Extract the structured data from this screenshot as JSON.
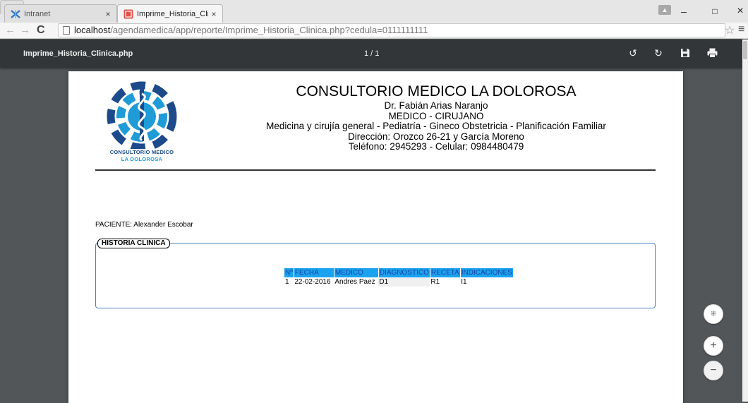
{
  "browser": {
    "tabs": [
      {
        "title": "Intranet",
        "active": false
      },
      {
        "title": "Imprime_Historia_Clinica.p",
        "active": true
      }
    ],
    "tab_close_glyph": "×",
    "url_host": "localhost",
    "url_path": "/agendamedica/app/reporte/Imprime_Historia_Clinica.php?cedula=0111111111",
    "window_controls": [
      "–",
      "□",
      "×"
    ]
  },
  "pdf_viewer": {
    "file_name": "Imprime_Historia_Clinica.php",
    "page_indicator": "1 / 1",
    "tools": [
      "rotate-counterclockwise-icon",
      "rotate-clockwise-icon",
      "save-icon",
      "print-icon"
    ],
    "zoom_controls": [
      "fit-page-icon",
      "zoom-in-icon",
      "zoom-out-icon"
    ]
  },
  "document": {
    "logo": {
      "line1": "CONSULTORIO MEDICO",
      "line2": "LA DOLOROSA",
      "colors": {
        "dark_blue": "#1c4a8a",
        "light_blue": "#1f9bd7"
      }
    },
    "header": {
      "clinic_name": "CONSULTORIO MEDICO LA DOLOROSA",
      "doctor": "Dr. Fabián Arias Naranjo",
      "title": "MEDICO - CIRUJANO",
      "specialties": "Medicina y cirujía general - Pediatría - Gineco Obstetricia - Planificación Familiar",
      "address": "Dirección: Orozco 26-21 y García Moreno",
      "phones": "Teléfono: 2945293 - Celular: 0984480479"
    },
    "patient_line": "PACIENTE: Alexander Escobar",
    "history": {
      "legend": "HISTORIA CLINICA",
      "columns": [
        "Nº",
        "FECHA",
        "MEDICO",
        "DIAGNOSTICO",
        "RECETA",
        "INDICACIONES"
      ],
      "rows": [
        [
          "1",
          "22-02-2016",
          "Andres Paez",
          "D1",
          "R1",
          "I1"
        ]
      ],
      "header_bg": "#1aa3f0",
      "header_fg": "#1e3fa0"
    }
  }
}
